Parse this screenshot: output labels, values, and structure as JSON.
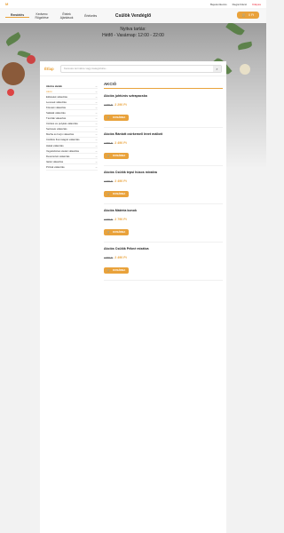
{
  "topbar": {
    "logo": "M",
    "links": [
      "Bejelentkezés",
      "Regisztráció",
      "Kilépés"
    ]
  },
  "nav": {
    "items": [
      "Rendelés",
      "Kedvenc Rögzítése",
      "Ételek Ajánlások",
      "Értékelés"
    ],
    "brand": "Csülök Vendéglő",
    "cart_label": "0 Ft"
  },
  "hours": {
    "title": "Nyitva tartás:",
    "range": "Hétfő - Vasárnap: 12:00 - 22:00"
  },
  "menu": {
    "label": "Étlap",
    "search_placeholder": "Keresés termékre vagy kategóriára...",
    "categories": [
      "Akciós ételek",
      "Akció",
      "Előételek választás",
      "Levesek választás",
      "Köretek választás",
      "Saláták választás",
      "Tészták választás",
      "Csirkés és pulykás választás",
      "Sertések választás",
      "Marha és borjú választás",
      "Csülkös finomságok választás",
      "Halak választás",
      "Vegetáriánus ételek választás",
      "Desszertek választás",
      "Italok választás",
      "Pizzák választás"
    ],
    "section_title": "AKCIÓ",
    "products": [
      {
        "name": "Akciós juhtúrós sztrapacska",
        "old": "2 690 Ft",
        "new": "2 290 Ft"
      },
      {
        "name": "Akciós Rántott csirkemell lévet mállott",
        "old": "2 890 Ft",
        "new": "2 490 Ft"
      },
      {
        "name": "Akciós Csülök tepsi húsos mixálva",
        "old": "2 990 Ft",
        "new": "2 490 Ft"
      },
      {
        "name": "Akciós Mátéria konok",
        "old": "2 990 Ft",
        "new": "2 790 Ft"
      },
      {
        "name": "Akciós Csülök Pékné mixálva",
        "old": "2 890 Ft",
        "new": "2 490 Ft"
      }
    ],
    "add_label": "KOSÁRBA"
  }
}
